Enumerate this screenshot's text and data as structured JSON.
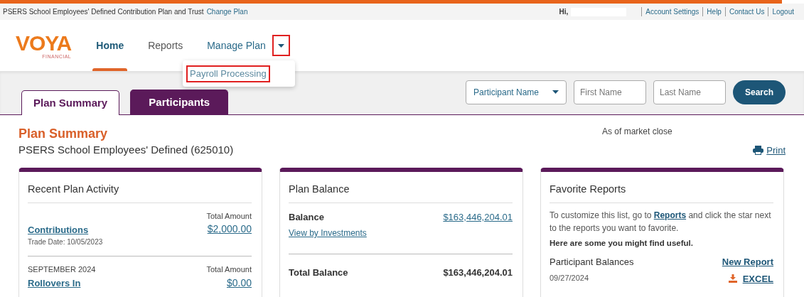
{
  "top_bar": {
    "plan_name": "PSERS School Employees' Defined Contribution Plan and Trust",
    "change_link": "Change Plan",
    "greeting": "Hi,",
    "links": [
      "Account Settings",
      "Help",
      "Contact Us",
      "Logout"
    ]
  },
  "logo": {
    "name": "VOYA",
    "tagline": "FINANCIAL"
  },
  "nav": {
    "items": [
      {
        "label": "Home",
        "selected": true,
        "has_menu": false
      },
      {
        "label": "Reports",
        "selected": false,
        "has_menu": false
      },
      {
        "label": "Manage Plan",
        "selected": false,
        "has_menu": true,
        "caret_highlighted": true
      }
    ],
    "dropdown": [
      {
        "label": "Payroll Processing",
        "highlighted": true
      }
    ]
  },
  "tabs": [
    {
      "label": "Plan Summary",
      "selected": true
    },
    {
      "label": "Participants",
      "selected": false
    }
  ],
  "search": {
    "filter": "Participant Name",
    "fields": [
      {
        "placeholder": "First Name"
      },
      {
        "placeholder": "Last Name"
      }
    ],
    "button": "Search"
  },
  "summary": {
    "title": "Plan Summary",
    "subtitle": "PSERS School Employees' Defined (625010)",
    "as_of": "As of market close",
    "print": "Print"
  },
  "recent_activity": {
    "title": "Recent Plan Activity",
    "rows": [
      {
        "period": "",
        "amount_header": "Total Amount",
        "link": "Contributions",
        "amount": "$2,000.00",
        "note": "Trade Date: 10/05/2023"
      },
      {
        "period": "SEPTEMBER 2024",
        "amount_header": "Total Amount",
        "link": "Rollovers In",
        "amount": "$0.00",
        "note": ""
      }
    ]
  },
  "plan_balance": {
    "title": "Plan Balance",
    "balance_label": "Balance",
    "balance_value": "$163,446,204.01",
    "view_link": "View by Investments",
    "total_label": "Total Balance",
    "total_value": "$163,446,204.01"
  },
  "favorites": {
    "title": "Favorite Reports",
    "intro_before": "To customize this list, go to",
    "intro_link": "Reports",
    "intro_after": "and click the star next to the reports you want to favorite.",
    "hint": "Here are some you might find useful.",
    "reports": [
      {
        "name": "Participant Balances",
        "action": "New Report",
        "date": "09/27/2024",
        "download": "EXCEL"
      }
    ]
  }
}
